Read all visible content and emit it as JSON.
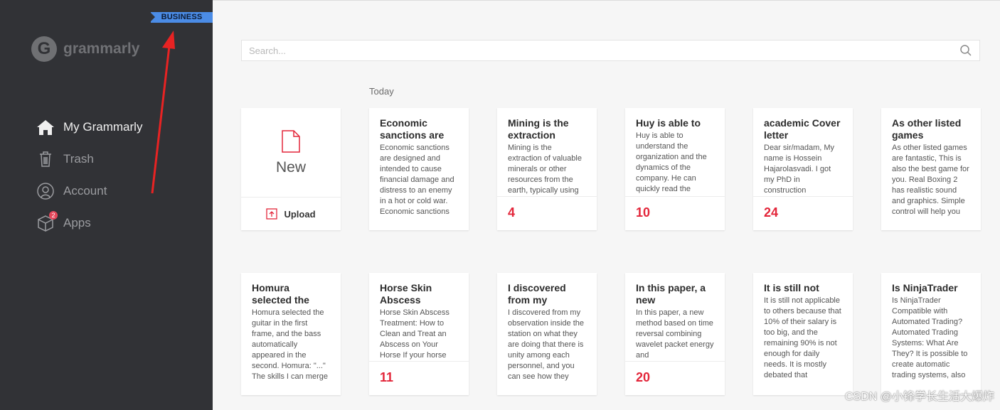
{
  "sidebar": {
    "badge": "BUSINESS",
    "logo_text": "grammarly",
    "items": [
      {
        "label": "My Grammarly",
        "icon": "home-icon",
        "active": true
      },
      {
        "label": "Trash",
        "icon": "trash-icon",
        "active": false
      },
      {
        "label": "Account",
        "icon": "account-icon",
        "active": false
      },
      {
        "label": "Apps",
        "icon": "apps-icon",
        "active": false,
        "count": "2"
      }
    ]
  },
  "search": {
    "placeholder": "Search..."
  },
  "section_label": "Today",
  "new_card": {
    "new_label": "New",
    "upload_label": "Upload"
  },
  "documents": [
    {
      "title": "Economic sanctions are",
      "excerpt": "Economic sanctions are designed and intended to cause financial damage and distress to an enemy in a hot or cold war. Economic sanctions",
      "count": ""
    },
    {
      "title": "Mining is the extraction",
      "excerpt": "Mining is the extraction of valuable minerals or other resources from the earth, typically using",
      "count": "4"
    },
    {
      "title": "Huy is able to",
      "excerpt": "Huy is able to understand the organization and the dynamics of the company. He can quickly read the",
      "count": "10"
    },
    {
      "title": "academic Cover letter",
      "excerpt": "Dear sir/madam, My name is Hossein Hajarolasvadi. I got my PhD in construction",
      "count": "24"
    },
    {
      "title": "As other listed games",
      "excerpt": "As other listed games are fantastic, This is also the best game for you. Real Boxing 2 has realistic sound and graphics. Simple control will help you",
      "count": ""
    },
    {
      "title": "Homura selected the",
      "excerpt": "Homura selected the guitar in the first frame, and the bass automatically appeared in the second. Homura: \"...\" The skills I can merge",
      "count": ""
    },
    {
      "title": "Horse Skin Abscess",
      "excerpt": "Horse Skin Abscess Treatment: How to Clean and Treat an Abscess on Your Horse If your horse",
      "count": "11"
    },
    {
      "title": "I discovered from my",
      "excerpt": "I discovered from my observation inside the station on what they are doing that there is unity among each personnel, and you can see how they",
      "count": ""
    },
    {
      "title": "In this paper, a new",
      "excerpt": "In this paper, a new method based on time reversal combining wavelet packet energy and",
      "count": "20"
    },
    {
      "title": "It is still not",
      "excerpt": "It is still not applicable to others because that 10% of their salary is too big, and the remaining 90% is not enough for daily needs. It is mostly debated that",
      "count": ""
    },
    {
      "title": "Is NinjaTrader",
      "excerpt": "Is NinjaTrader Compatible with Automated Trading? Automated Trading Systems: What Are They? It is possible to create automatic trading systems, also",
      "count": ""
    }
  ],
  "watermark": "CSDN @小锋学长生活大爆炸",
  "colors": {
    "sidebar": "#313236",
    "accent_red": "#e3263a",
    "badge": "#4b8ce6",
    "annotation_arrow": "#e82323"
  }
}
